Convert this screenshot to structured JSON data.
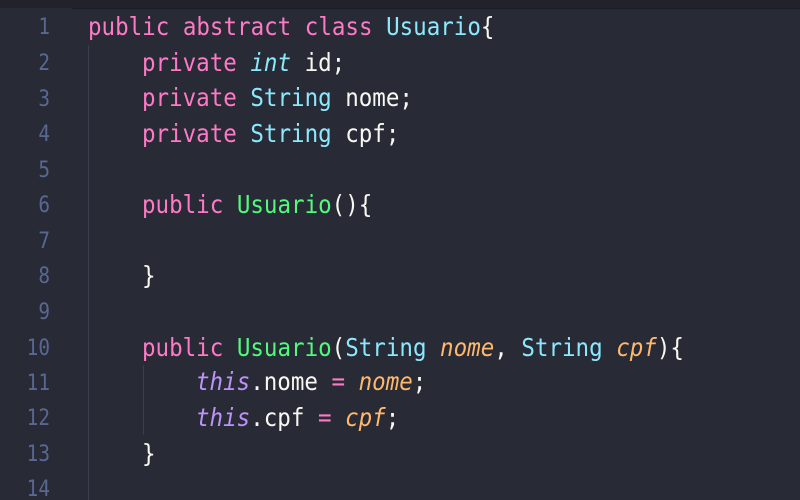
{
  "editor": {
    "theme_colors": {
      "background": "#282a36",
      "keyword": "#ff79c6",
      "type": "#8be9fd",
      "function": "#50fa7b",
      "parameter": "#ffb86c",
      "this": "#bd93f9",
      "line_number": "#6272a4"
    },
    "line_numbers": [
      "1",
      "2",
      "3",
      "4",
      "5",
      "6",
      "7",
      "8",
      "9",
      "10",
      "11",
      "12",
      "13",
      "14"
    ],
    "lines": {
      "l1": {
        "public": "public",
        "abstract": "abstract",
        "class": "class",
        "name": "Usuario",
        "brace": "{"
      },
      "l2": {
        "private": "private",
        "int": "int",
        "rest": " id;"
      },
      "l3": {
        "private": "private",
        "string": "String",
        "rest": " nome;"
      },
      "l4": {
        "private": "private",
        "string": "String",
        "rest": " cpf;"
      },
      "l6": {
        "public": "public",
        "name": "Usuario",
        "rest": "(){"
      },
      "l8": {
        "rest": "}"
      },
      "l10": {
        "public": "public",
        "name": "Usuario",
        "open": "(",
        "string1": "String",
        "param1": "nome",
        "comma": ", ",
        "string2": "String",
        "param2": "cpf",
        "close": "){"
      },
      "l11": {
        "this": "this",
        "field": ".nome",
        "eq": "=",
        "param": "nome",
        "semi": ";"
      },
      "l12": {
        "this": "this",
        "field": ".cpf",
        "eq": "=",
        "param": "cpf",
        "semi": ";"
      },
      "l13": {
        "rest": "}"
      }
    }
  }
}
